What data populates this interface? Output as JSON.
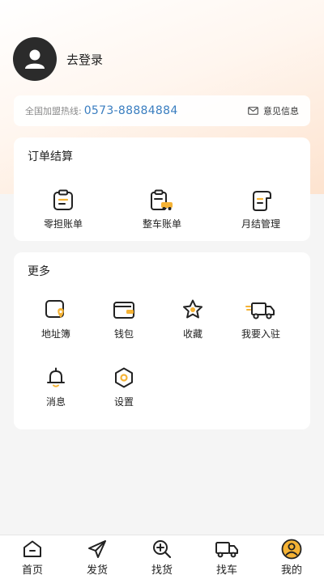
{
  "profile": {
    "login_label": "去登录",
    "avatar_icon": "user-avatar-icon"
  },
  "hotline": {
    "label": "全国加盟热线:",
    "number": "0573-88884884",
    "feedback_label": "意见信息",
    "number_color": "#3a7ec0"
  },
  "orders": {
    "title": "订单结算",
    "items": [
      {
        "label": "零担账单",
        "icon": "ledger-icon"
      },
      {
        "label": "整车账单",
        "icon": "truck-bill-icon"
      },
      {
        "label": "月结管理",
        "icon": "monthly-manage-icon"
      }
    ]
  },
  "more": {
    "title": "更多",
    "items": [
      {
        "label": "地址簿",
        "icon": "address-book-icon"
      },
      {
        "label": "钱包",
        "icon": "wallet-icon"
      },
      {
        "label": "收藏",
        "icon": "star-icon"
      },
      {
        "label": "我要入驻",
        "icon": "delivery-truck-icon"
      },
      {
        "label": "消息",
        "icon": "bell-icon"
      },
      {
        "label": "设置",
        "icon": "settings-icon"
      }
    ]
  },
  "tabbar": {
    "items": [
      {
        "label": "首页",
        "icon": "home-icon"
      },
      {
        "label": "发货",
        "icon": "send-icon"
      },
      {
        "label": "找货",
        "icon": "search-goods-icon"
      },
      {
        "label": "找车",
        "icon": "truck-icon"
      },
      {
        "label": "我的",
        "icon": "profile-icon",
        "active": true
      }
    ]
  },
  "colors": {
    "accent": "#f5b335",
    "text": "#222222"
  }
}
